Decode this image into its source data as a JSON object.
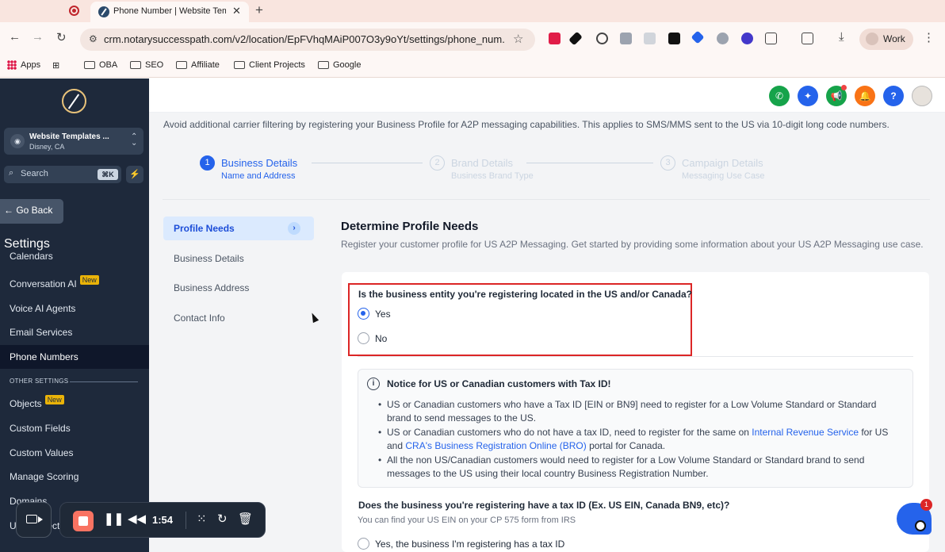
{
  "browser": {
    "tab_title": "Phone Number | Website Tem",
    "url": "crm.notarysuccesspath.com/v2/location/EpFVhqMAiP007O3y9oYt/settings/phone_num...",
    "profile_label": "Work",
    "bookmarks": [
      "Apps",
      "OBA",
      "SEO",
      "Affiliate",
      "Client Projects",
      "Google"
    ]
  },
  "sidebar": {
    "location_name": "Website Templates ...",
    "location_sub": "Disney, CA",
    "search_placeholder": "Search",
    "search_shortcut": "⌘K",
    "go_back": "← Go Back",
    "section_title": "Settings",
    "items": [
      {
        "label": "Calendars"
      },
      {
        "label": "Conversation AI",
        "badge": "New"
      },
      {
        "label": "Voice AI Agents"
      },
      {
        "label": "Email Services"
      },
      {
        "label": "Phone Numbers",
        "active": true
      },
      {
        "label": "Objects",
        "badge": "New"
      },
      {
        "label": "Custom Fields"
      },
      {
        "label": "Custom Values"
      },
      {
        "label": "Manage Scoring"
      },
      {
        "label": "Domains"
      },
      {
        "label": "Url Redirects"
      }
    ],
    "other_settings_label": "OTHER SETTINGS"
  },
  "header": {
    "icons": [
      "phone-icon",
      "magic-icon",
      "megaphone-icon",
      "bell-icon",
      "help-icon"
    ],
    "colors": {
      "phone": "#16a34a",
      "magic": "#2563eb",
      "megaphone": "#16a34a",
      "bell": "#f97316",
      "help": "#2563eb"
    }
  },
  "main": {
    "intro": "Avoid additional carrier filtering by registering your Business Profile for A2P messaging capabilities. This applies to SMS/MMS sent to the US via 10-digit long code numbers.",
    "steps": [
      {
        "num": "1",
        "title": "Business Details",
        "sub": "Name and Address",
        "active": true
      },
      {
        "num": "2",
        "title": "Brand Details",
        "sub": "Business Brand Type",
        "active": false
      },
      {
        "num": "3",
        "title": "Campaign Details",
        "sub": "Messaging Use Case",
        "active": false
      }
    ],
    "subnav": [
      "Profile Needs",
      "Business Details",
      "Business Address",
      "Contact Info"
    ],
    "card_title": "Determine Profile Needs",
    "card_desc": "Register your customer profile for US A2P Messaging. Get started by providing some information about your US A2P Messaging use case.",
    "q1": {
      "text": "Is the business entity you're registering located in the US and/or Canada?",
      "options": [
        "Yes",
        "No"
      ],
      "selected": "Yes"
    },
    "notice": {
      "title": "Notice for US or Canadian customers with Tax ID!",
      "b1": "US or Canadian customers who have a Tax ID [EIN or BN9] need to register for a Low Volume Standard or Standard brand to send messages to the US.",
      "b2_pre": "US or Canadian customers who do not have a tax ID, need to register for the same on ",
      "b2_link1": "Internal Revenue Service",
      "b2_mid": " for US and ",
      "b2_link2": "CRA's Business Registration Online (BRO)",
      "b2_post": " portal for Canada.",
      "b3": "All the non US/Canadian customers would need to register for a Low Volume Standard or Standard brand to send messages to the US using their local country Business Registration Number."
    },
    "q2": {
      "text": "Does the business you're registering have a tax ID (Ex. US EIN, Canada BN9, etc)?",
      "help": "You can find your US EIN on your CP 575 form from IRS",
      "option_visible": "Yes, the business I'm registering has a tax ID"
    }
  },
  "recorder": {
    "time": "1:54"
  },
  "chat": {
    "badge": "1"
  }
}
